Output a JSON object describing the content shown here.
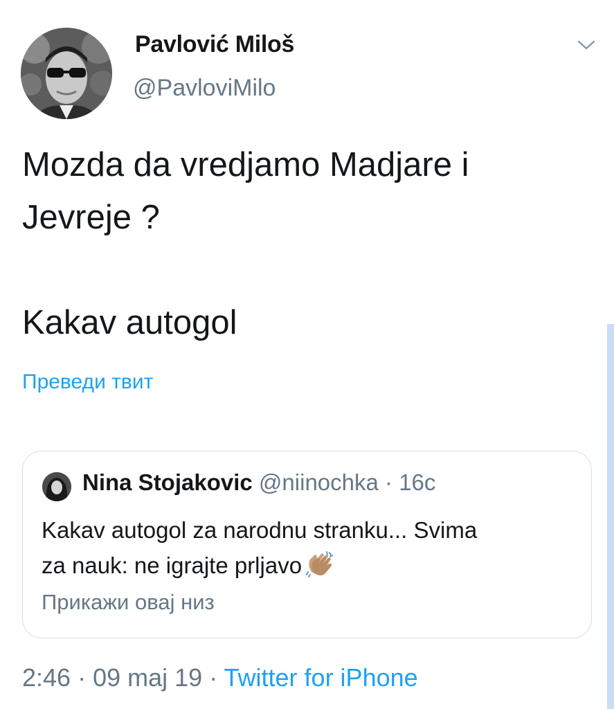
{
  "author": {
    "name": "Pavlović Miloš",
    "handle": "@PavloviMilo"
  },
  "tweet": {
    "lines": [
      "Mozda da vredjamo Madjare i",
      "Jevreje ?"
    ],
    "line2": "Kakav autogol",
    "translate_label": "Преведи твит"
  },
  "quote": {
    "name": "Nina Stojakovic",
    "handle": "@niinochka",
    "separator": " · ",
    "time": "16c",
    "text_line1": "Kakav autogol za narodnu stranku... Svima",
    "text_line2": "za nauk: ne igrajte prljavo",
    "emoji": "clapping-hands-icon",
    "show_thread_label": "Прикажи овај низ"
  },
  "meta": {
    "time": "2:46",
    "separator": " · ",
    "date": "09 maj 19",
    "source": "Twitter for iPhone"
  },
  "colors": {
    "link": "#1da1f2",
    "secondary_text": "#657786",
    "primary_text": "#14171a",
    "border": "#d8dee3"
  },
  "icons": {
    "menu": "chevron-down-icon",
    "avatar": "avatar",
    "quote_avatar": "avatar"
  }
}
